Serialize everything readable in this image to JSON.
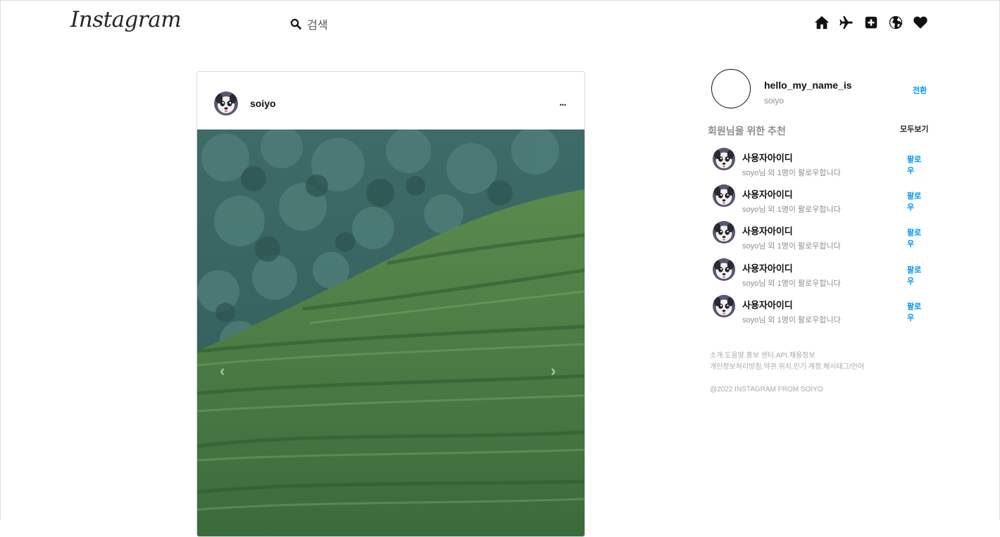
{
  "header": {
    "logo": "Instagram",
    "search_placeholder": "검색",
    "nav_icons": [
      "home-icon",
      "paper-plane-icon",
      "add-post-icon",
      "explore-globe-icon",
      "heart-icon"
    ]
  },
  "post": {
    "username": "soiyo",
    "more": "...",
    "prev_arrow": "‹",
    "next_arrow": "›"
  },
  "sidebar": {
    "me_username": "hello_my_name_is",
    "me_name": "soiyo",
    "switch_label": "전환",
    "recommend_title": "회원님을 위한 추천",
    "see_all": "모두보기",
    "recommendations": [
      {
        "user": "사용자아이디",
        "sub": "soyo님 외 1명이 팔로우합니다",
        "follow": "팔로우"
      },
      {
        "user": "사용자아이디",
        "sub": "soyo님 외 1명이 팔로우합니다",
        "follow": "팔로우"
      },
      {
        "user": "사용자아이디",
        "sub": "soyo님 외 1명이 팔로우합니다",
        "follow": "팔로우"
      },
      {
        "user": "사용자아이디",
        "sub": "soyo님 외 1명이 팔로우합니다",
        "follow": "팔로우"
      },
      {
        "user": "사용자아이디",
        "sub": "soyo님 외 1명이 팔로우합니다",
        "follow": "팔로우"
      }
    ],
    "footer_line1": "소개.도움말.홍보 센터.API.채용정보",
    "footer_line2": "개인정보처리방침.약관.위치.인기 계정.해시태그/언어",
    "copyright": "@2022 INSTAGRAM FROM SOIYO"
  },
  "colors": {
    "accent": "#0095f6",
    "muted": "#8e8e8e",
    "border": "#dbdbdb"
  }
}
